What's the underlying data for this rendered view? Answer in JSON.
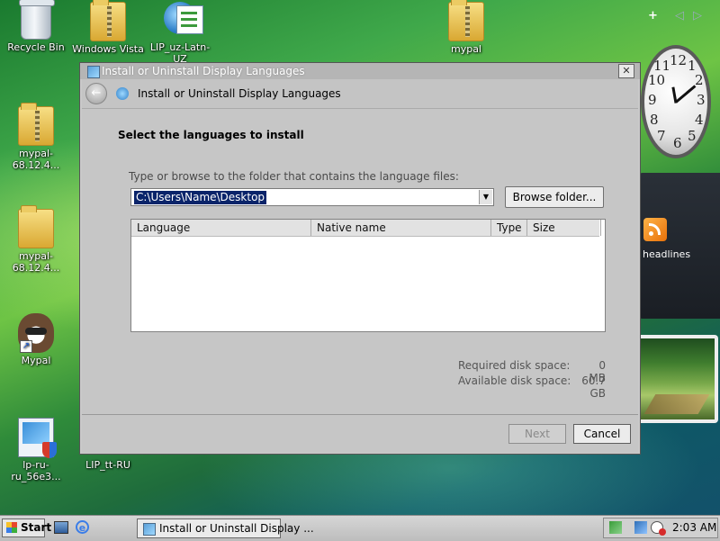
{
  "desktop": {
    "icons": [
      {
        "label": "Recycle Bin"
      },
      {
        "label": "Windows Vista"
      },
      {
        "label": "LIP_uz-Latn-UZ"
      },
      {
        "label": "mypal"
      },
      {
        "label": "mypal-68.12.4..."
      },
      {
        "label": "mypal-68.12.4..."
      },
      {
        "label": "Mypal"
      },
      {
        "label": "lp-ru-ru_56e3..."
      },
      {
        "label": "LIP_tt-RU"
      }
    ]
  },
  "sidebar": {
    "add_glyph": "+",
    "prev_glyph": "◁",
    "next_glyph": "▷",
    "clock_numbers": [
      "12",
      "1",
      "2",
      "3",
      "4",
      "5",
      "6",
      "7",
      "8",
      "9",
      "10",
      "11"
    ],
    "feed_text": "headlines"
  },
  "window": {
    "title": "Install or Uninstall Display Languages",
    "close_glyph": "✕",
    "nav_title": "Install or Uninstall Display Languages",
    "back_glyph": "←",
    "heading": "Select the languages to install",
    "path_label": "Type or browse to the folder that contains the language files:",
    "path_value": "C:\\Users\\Name\\Desktop",
    "combo_arrow": "▼",
    "browse_label": "Browse folder...",
    "table_headers": [
      "Language",
      "Native name",
      "Type",
      "Size"
    ],
    "disk_required_label": "Required disk space:",
    "disk_required_value": "0 MB",
    "disk_available_label": "Available disk space:",
    "disk_available_value": "60.7 GB",
    "next_label": "Next",
    "cancel_label": "Cancel"
  },
  "taskbar": {
    "start_label": "Start",
    "ie_glyph": "e",
    "task_label": "Install or Uninstall Display ...",
    "time": "2:03 AM"
  }
}
